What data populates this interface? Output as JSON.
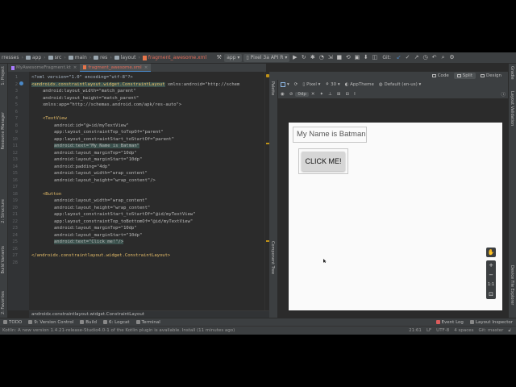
{
  "toolbar": {
    "crumbs": [
      "rresses",
      "app",
      "src",
      "main",
      "res",
      "layout",
      "fragment_awesome.xml"
    ],
    "run_config": "app",
    "device": "Pixel 3a API R",
    "git_label": "Git:"
  },
  "tabs": [
    {
      "label": "MyAwesomeFragment.kt",
      "active": false
    },
    {
      "label": "fragment_awesome.xml",
      "active": true
    }
  ],
  "left_tools": [
    "1: Project",
    "Resource Manager",
    "2: Structure",
    "Build Variants",
    "2: Favorites"
  ],
  "right_tools": [
    "Gradle",
    "Layout Validation",
    "Device File Explorer"
  ],
  "editor": {
    "line_numbers": [
      "1",
      "2",
      "3",
      "4",
      "5",
      "6",
      "7",
      "8",
      "9",
      "10",
      "11",
      "12",
      "13",
      "14",
      "15",
      "16",
      "17",
      "18",
      "19",
      "20",
      "21",
      "22",
      "23",
      "24",
      "25",
      "26",
      "27",
      "28"
    ],
    "line1": "<?xml version=\"1.0\" encoding=\"utf-8\"?>",
    "line2_tag": "<androidx.constraintlayout.widget.ConstraintLayout",
    "line2_rest": " xmlns:android=\"http://schem",
    "line3": "android:layout_width=\"match_parent\"",
    "line4": "android:layout_height=\"match_parent\"",
    "line5": "xmlns:app=\"http://schemas.android.com/apk/res-auto\">",
    "line7": "<TextView",
    "line8": "android:id=\"@+id/myTextView\"",
    "line9": "app:layout_constraintTop_toTopOf=\"parent\"",
    "line10": "app:layout_constraintStart_toStartOf=\"parent\"",
    "line11": "android:text=\"My Name is Batman\"",
    "line12": "android:layout_marginTop=\"10dp\"",
    "line13": "android:layout_marginStart=\"10dp\"",
    "line14": "android:padding=\"4dp\"",
    "line15": "android:layout_width=\"wrap_content\"",
    "line16": "android:layout_height=\"wrap_content\"/>",
    "line18": "<Button",
    "line19": "android:layout_width=\"wrap_content\"",
    "line20": "android:layout_height=\"wrap_content\"",
    "line21": "app:layout_constraintStart_toStartOf=\"@id/myTextView\"",
    "line22": "app:layout_constraintTop_toBottomOf=\"@id/myTextView\"",
    "line23": "android:layout_marginTop=\"10dp\"",
    "line24": "android:layout_marginStart=\"10dp\"",
    "line25": "android:text=\"Click me!\"/>",
    "line27": "</androidx.constraintlayout.widget.ConstraintLayout>",
    "breadcrumb": "androidx.constraintlayout.widget.ConstraintLayout"
  },
  "design": {
    "modes": [
      "Code",
      "Split",
      "Design"
    ],
    "active_mode": "Split",
    "palette_label": "Palette",
    "component_tree_label": "Component Tree",
    "device": "Pixel",
    "api": "30",
    "theme": "AppTheme",
    "locale": "Default (en-us)",
    "margin": "0dp",
    "textview_text": "My Name is Batman",
    "button_text": "CLICK ME!",
    "zoom_ratio": "1:1"
  },
  "bottom_tabs": [
    "TODO",
    "9: Version Control",
    "Build",
    "6: Logcat",
    "Terminal",
    "Event Log",
    "Layout Inspector"
  ],
  "status": {
    "message": "Kotlin: A new version 1.4.21-release-Studio4.0-1 of the Kotlin plugin is available. Install (11 minutes ago)",
    "position": "21:61",
    "line_sep": "LF",
    "encoding": "UTF-8",
    "indent": "4 spaces",
    "branch": "Git: master"
  },
  "colors": {
    "accent": "#4a88c7",
    "tag": "#e8bf6a",
    "value": "#6a8759",
    "namespace": "#9876aa"
  }
}
